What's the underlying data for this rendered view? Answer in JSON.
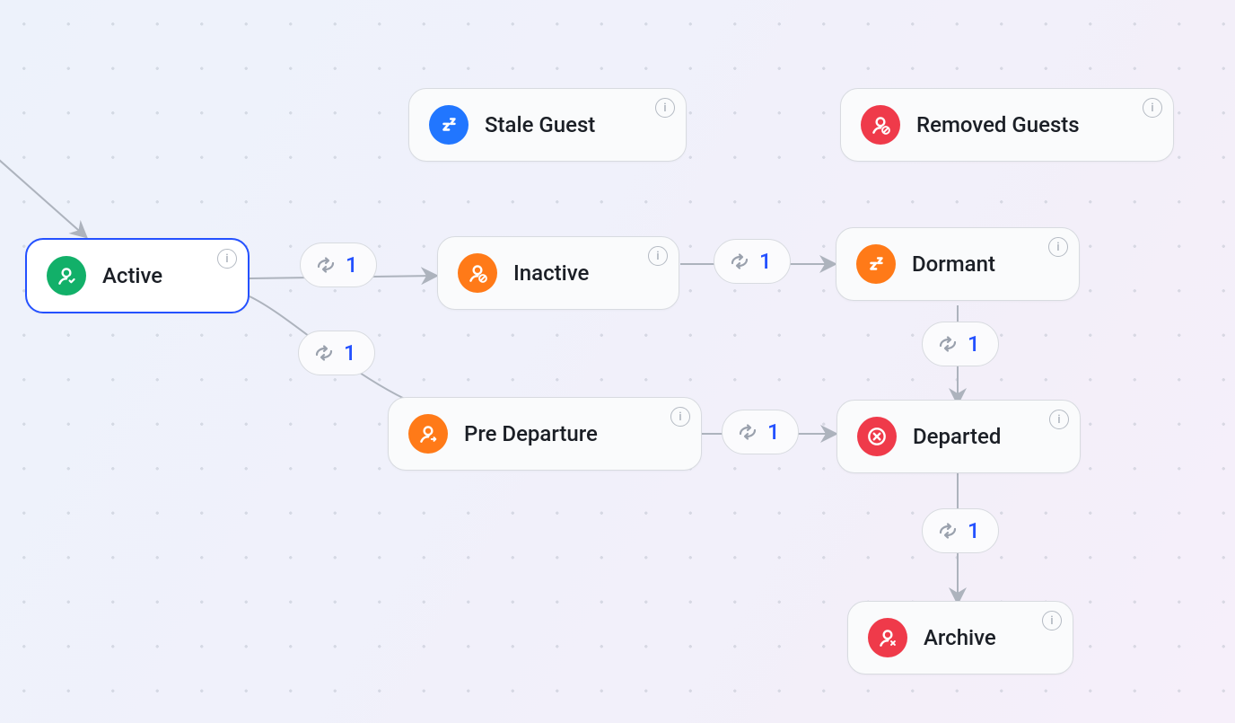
{
  "nodes": {
    "active": {
      "label": "Active"
    },
    "stale_guest": {
      "label": "Stale Guest"
    },
    "removed_guests": {
      "label": "Removed Guests"
    },
    "inactive": {
      "label": "Inactive"
    },
    "dormant": {
      "label": "Dormant"
    },
    "pre_departure": {
      "label": "Pre Departure"
    },
    "departed": {
      "label": "Departed"
    },
    "archive": {
      "label": "Archive"
    }
  },
  "edges": {
    "active_to_inactive": {
      "count": "1"
    },
    "inactive_to_dormant": {
      "count": "1"
    },
    "active_to_predeparture": {
      "count": "1"
    },
    "predeparture_to_departed": {
      "count": "1"
    },
    "dormant_to_departed": {
      "count": "1"
    },
    "departed_to_archive": {
      "count": "1"
    }
  },
  "colors": {
    "green": "#12b069",
    "blue": "#2176ff",
    "orange": "#ff7a18",
    "red": "#ef3a4a",
    "edge_number": "#2451ff",
    "selection": "#2451ff"
  }
}
